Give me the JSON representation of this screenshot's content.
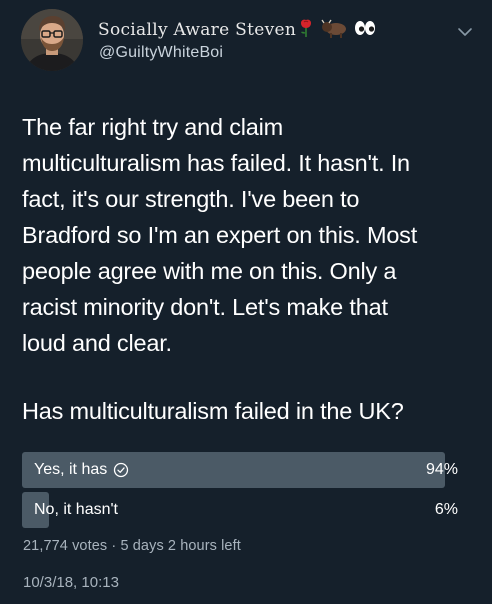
{
  "user": {
    "display_name": "Socially Aware Steven",
    "handle": "@GuiltyWhiteBoi",
    "name_emojis": [
      "rose-icon",
      "bison-icon",
      "eyes-icon"
    ]
  },
  "tweet": {
    "text_lines": [
      "The far right try and claim",
      "multiculturalism has failed. It hasn't. In",
      "fact, it's our strength. I've been to",
      "Bradford so I'm an expert on this. Most",
      "people agree with me on this. Only a",
      "racist minority don't. Let's make that",
      "loud and clear."
    ]
  },
  "poll": {
    "question": "Has multiculturalism failed in the UK?",
    "options": [
      {
        "label": "Yes, it has",
        "percent_text": "94%",
        "share": 0.94,
        "selected": true
      },
      {
        "label": "No, it hasn't",
        "percent_text": "6%",
        "share": 0.06,
        "selected": false
      }
    ],
    "votes": "21,774 votes",
    "separator": "·",
    "time_left": "5 days 2 hours left"
  },
  "timestamp": "10/3/18, 10:13",
  "colors": {
    "background": "#15202b",
    "poll_fill": "#4b5a66",
    "secondary_text": "#a8b3bd"
  }
}
